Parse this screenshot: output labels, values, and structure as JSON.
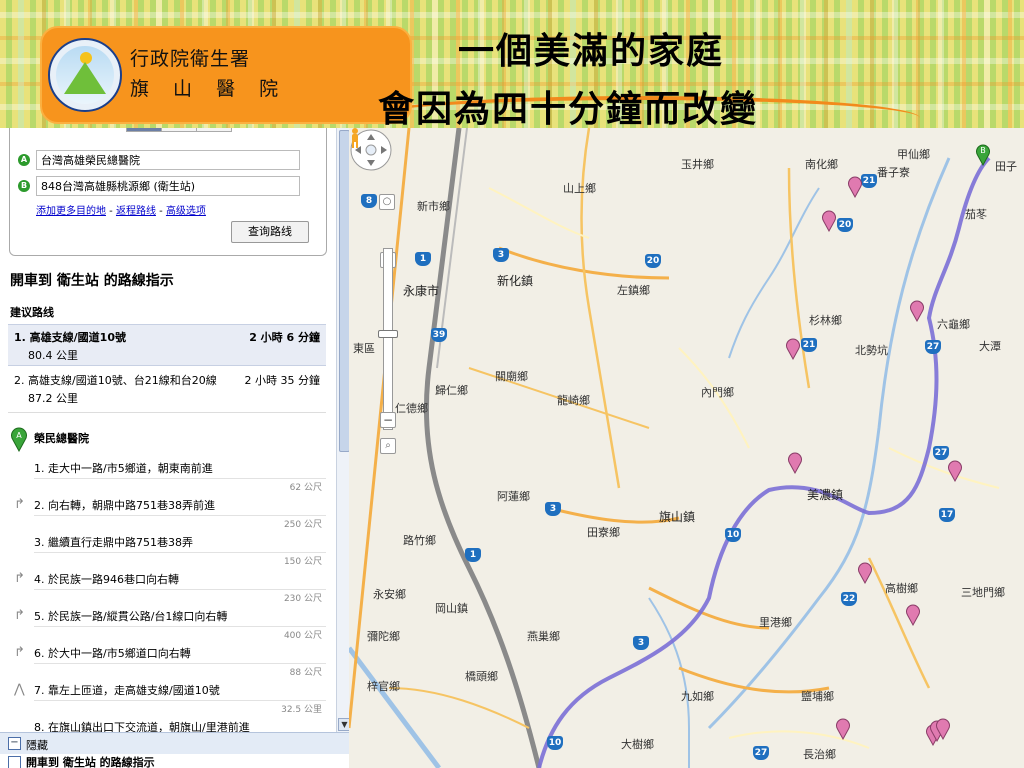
{
  "header": {
    "org_line1": "行政院衛生署",
    "org_line2": "旗 山 醫 院",
    "title_line1": "一個美滿的家庭",
    "title_line2": "會因為四十分鐘而改變"
  },
  "directions": {
    "travel_modes": [
      "car-icon",
      "transit-icon",
      "walk-icon"
    ],
    "origin_marker": "A",
    "origin": "台灣高雄榮民總醫院",
    "destination_marker": "B",
    "destination": "848台灣高雄縣桃源鄉 (衛生站)",
    "link_add_destination": "添加更多目的地",
    "link_return_route": "返程路线",
    "link_advanced": "高级选项",
    "link_sep": " - ",
    "query_button": "查询路线",
    "heading": "開車到 衛生站 的路線指示",
    "suggested_label": "建议路线",
    "routes": [
      {
        "name": "1. 高雄支線/國道10號",
        "time": "2 小時 6 分鐘",
        "distance": "80.4 公里",
        "selected": true
      },
      {
        "name": "2. 高雄支線/國道10號、台21線和台20線",
        "time": "2 小時 35 分鐘",
        "distance": "87.2 公里",
        "selected": false
      }
    ],
    "start_label": "榮民總醫院",
    "steps": [
      {
        "icon": "none",
        "text": "1. 走大中一路/市5鄉道，朝東南前進",
        "distance": "62 公尺"
      },
      {
        "icon": "turn-right-icon",
        "text": "2. 向右轉，朝鼎中路751巷38弄前進",
        "distance": "250 公尺"
      },
      {
        "icon": "none",
        "text": "3. 繼續直行走鼎中路751巷38弄",
        "distance": "150 公尺"
      },
      {
        "icon": "turn-right-icon",
        "text": "4. 於民族一路946巷口向右轉",
        "distance": "230 公尺"
      },
      {
        "icon": "turn-right-icon",
        "text": "5. 於民族一路/縱貫公路/台1線口向右轉",
        "distance": "400 公尺"
      },
      {
        "icon": "turn-right-icon",
        "text": "6. 於大中一路/市5鄉道口向右轉",
        "distance": "88 公尺"
      },
      {
        "icon": "keep-left-icon",
        "text": "7. 靠左上匝道，走高雄支線/國道10號",
        "distance": "32.5 公里"
      },
      {
        "icon": "none",
        "text": "8. 在旗山鎮出口下交流道，朝旗山/里港前進",
        "distance": ""
      }
    ],
    "hide_label": "隱藏",
    "footer_label": "開車到 衛生站 的路線指示"
  },
  "map": {
    "route_color": "#7b6fd6",
    "pin_color": "#e07ab0",
    "places": [
      {
        "name": "甲仙鄉",
        "cls": "place"
      },
      {
        "name": "南化鄉",
        "cls": "place"
      },
      {
        "name": "玉井鄉",
        "cls": "place"
      },
      {
        "name": "山上鄉",
        "cls": "place"
      },
      {
        "name": "新市鄉",
        "cls": "place"
      },
      {
        "name": "新化鎮",
        "cls": "place major"
      },
      {
        "name": "永康市",
        "cls": "place major"
      },
      {
        "name": "左鎮鄉",
        "cls": "place"
      },
      {
        "name": "杉林鄉",
        "cls": "place"
      },
      {
        "name": "六龜鄉",
        "cls": "place"
      },
      {
        "name": "內門鄉",
        "cls": "place"
      },
      {
        "name": "關廟鄉",
        "cls": "place"
      },
      {
        "name": "歸仁鄉",
        "cls": "place"
      },
      {
        "name": "龍崎鄉",
        "cls": "place"
      },
      {
        "name": "東區",
        "cls": "place"
      },
      {
        "name": "仁德鄉",
        "cls": "place"
      },
      {
        "name": "美濃鎮",
        "cls": "place major"
      },
      {
        "name": "旗山鎮",
        "cls": "place major"
      },
      {
        "name": "阿蓮鄉",
        "cls": "place"
      },
      {
        "name": "田寮鄉",
        "cls": "place"
      },
      {
        "name": "路竹鄉",
        "cls": "place"
      },
      {
        "name": "永安鄉",
        "cls": "place"
      },
      {
        "name": "岡山鎮",
        "cls": "place"
      },
      {
        "name": "高樹鄉",
        "cls": "place"
      },
      {
        "name": "三地門鄉",
        "cls": "place"
      },
      {
        "name": "里港鄉",
        "cls": "place"
      },
      {
        "name": "燕巢鄉",
        "cls": "place"
      },
      {
        "name": "彌陀鄉",
        "cls": "place"
      },
      {
        "name": "橋頭鄉",
        "cls": "place"
      },
      {
        "name": "梓官鄉",
        "cls": "place"
      },
      {
        "name": "九如鄉",
        "cls": "place"
      },
      {
        "name": "鹽埔鄉",
        "cls": "place"
      },
      {
        "name": "大樹鄉",
        "cls": "place"
      },
      {
        "name": "長治鄉",
        "cls": "place"
      },
      {
        "name": "北勢坑",
        "cls": "place"
      },
      {
        "name": "番子寮",
        "cls": "place"
      },
      {
        "name": "田子",
        "cls": "place"
      },
      {
        "name": "茄苳",
        "cls": "place"
      },
      {
        "name": "大潭",
        "cls": "place"
      }
    ],
    "shields": [
      "21",
      "20",
      "3",
      "1",
      "39",
      "3",
      "20",
      "21",
      "27",
      "27",
      "10",
      "22",
      "1",
      "17",
      "8",
      "3",
      "27",
      "10"
    ],
    "end_marker": "B"
  }
}
